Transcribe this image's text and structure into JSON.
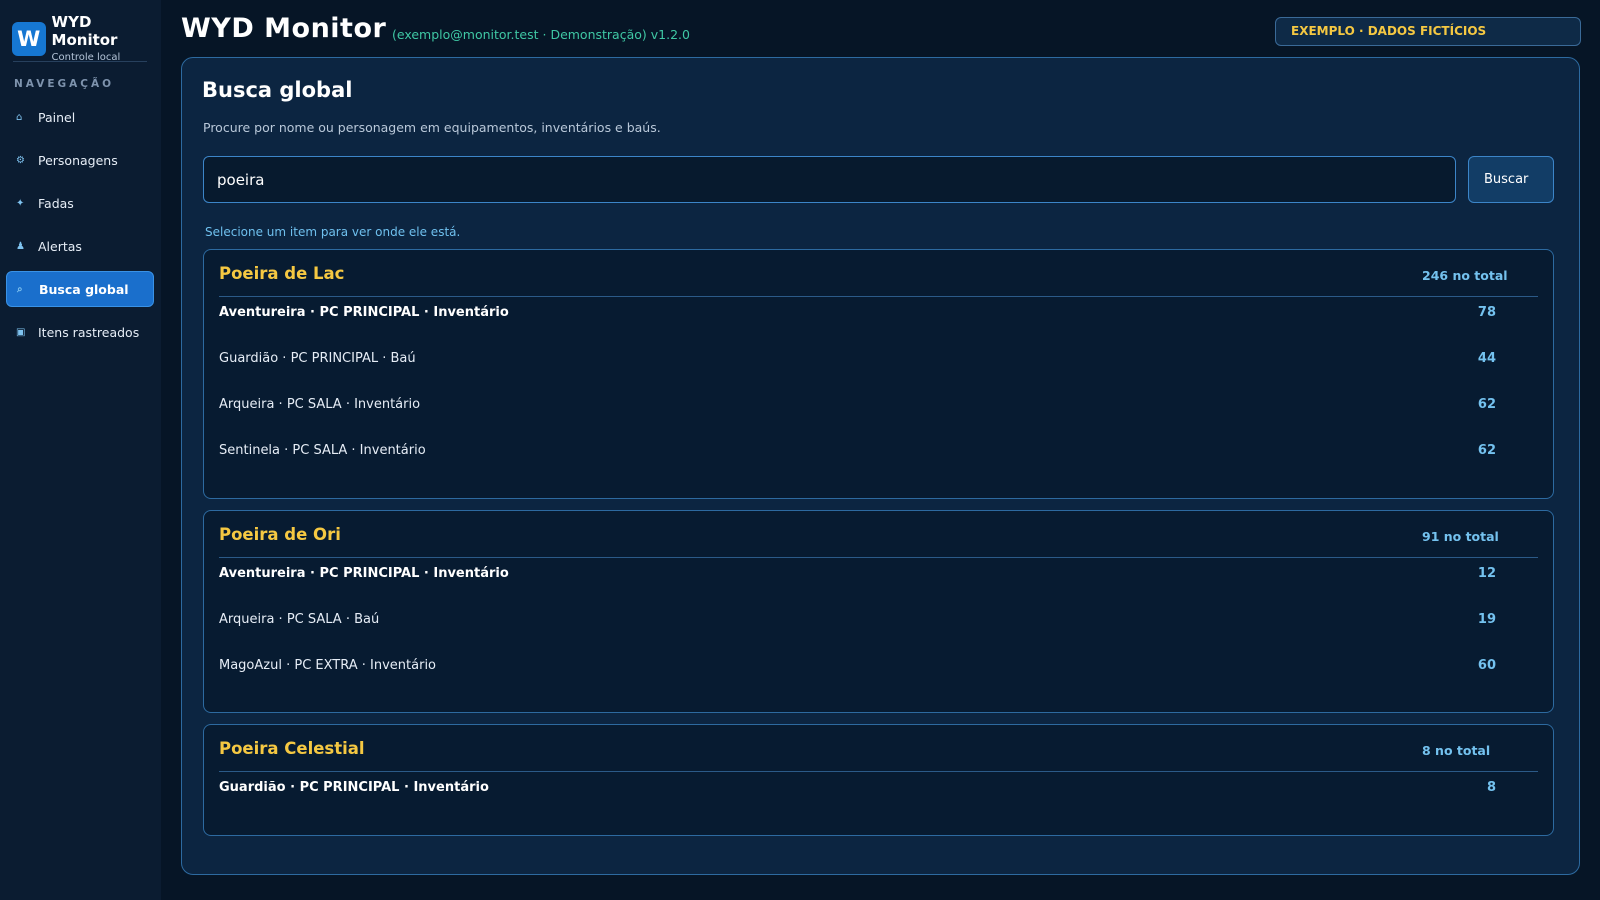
{
  "sidebar": {
    "logo_letter": "W",
    "app_name": "WYD Monitor",
    "app_sub": "Controle local",
    "nav_title": "NAVEGAÇÃO",
    "items": [
      {
        "label": "Painel",
        "icon": "home-icon",
        "glyph": "⌂",
        "active": false
      },
      {
        "label": "Personagens",
        "icon": "gear-icon",
        "glyph": "⚙",
        "active": false
      },
      {
        "label": "Fadas",
        "icon": "sparkle-icon",
        "glyph": "✦",
        "active": false
      },
      {
        "label": "Alertas",
        "icon": "pawn-icon",
        "glyph": "♟",
        "active": false
      },
      {
        "label": "Busca global",
        "icon": "search-icon",
        "glyph": "⌕",
        "active": true
      },
      {
        "label": "Itens rastreados",
        "icon": "box-icon",
        "glyph": "▣",
        "active": false
      }
    ]
  },
  "header": {
    "title": "WYD Monitor",
    "account_info": "(exemplo@monitor.test · Demonstração)  v1.2.0",
    "banner": "EXEMPLO · DADOS FICTÍCIOS"
  },
  "search": {
    "title": "Busca global",
    "description": "Procure por nome ou personagem em equipamentos, inventários e baús.",
    "query": "poeira",
    "button_label": "Buscar",
    "hint": "Selecione um item para ver onde ele está."
  },
  "results": [
    {
      "name": "Poeira de Lac",
      "total": "246 no total",
      "rows": [
        {
          "location": "Aventureira · PC PRINCIPAL · Inventário",
          "qty": "78",
          "strong": true
        },
        {
          "location": "Guardião · PC PRINCIPAL · Baú",
          "qty": "44",
          "strong": false
        },
        {
          "location": "Arqueira · PC SALA · Inventário",
          "qty": "62",
          "strong": false
        },
        {
          "location": "Sentinela · PC SALA · Inventário",
          "qty": "62",
          "strong": false
        }
      ]
    },
    {
      "name": "Poeira de Ori",
      "total": "91 no total",
      "rows": [
        {
          "location": "Aventureira · PC PRINCIPAL · Inventário",
          "qty": "12",
          "strong": true
        },
        {
          "location": "Arqueira · PC SALA · Baú",
          "qty": "19",
          "strong": false
        },
        {
          "location": "MagoAzul · PC EXTRA · Inventário",
          "qty": "60",
          "strong": false
        }
      ]
    },
    {
      "name": "Poeira Celestial",
      "total": "8 no total",
      "rows": [
        {
          "location": "Guardião · PC PRINCIPAL · Inventário",
          "qty": "8",
          "strong": true
        }
      ]
    }
  ],
  "colors": {
    "accent": "#1a6fcc",
    "item_name": "#f5c842",
    "quantity": "#74c2ef",
    "info_text": "#3fc7a4"
  }
}
